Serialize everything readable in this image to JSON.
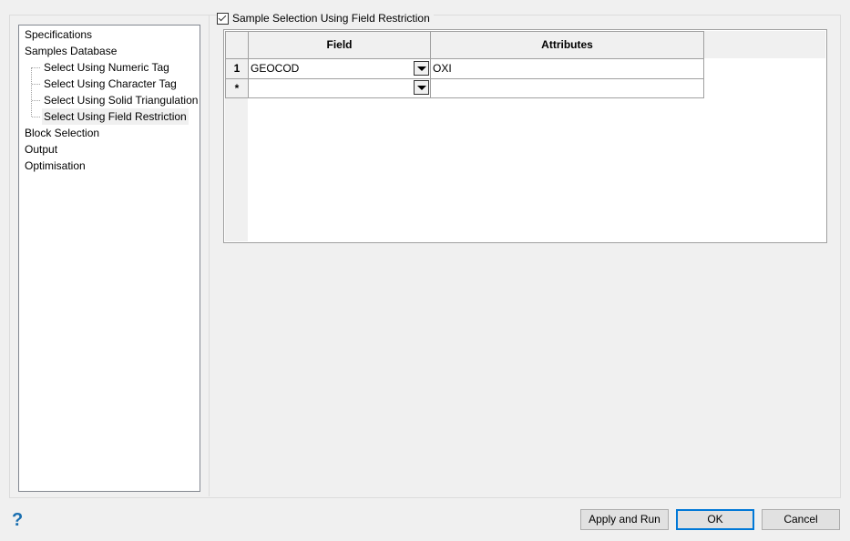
{
  "tree": {
    "items": [
      {
        "label": "Specifications",
        "child": false,
        "selected": false
      },
      {
        "label": "Samples Database",
        "child": false,
        "selected": false
      },
      {
        "label": "Select Using Numeric Tag",
        "child": true,
        "selected": false
      },
      {
        "label": "Select Using Character Tag",
        "child": true,
        "selected": false
      },
      {
        "label": "Select Using Solid Triangulation",
        "child": true,
        "selected": false
      },
      {
        "label": "Select Using Field Restriction",
        "child": true,
        "selected": true
      },
      {
        "label": "Block Selection",
        "child": false,
        "selected": false
      },
      {
        "label": "Output",
        "child": false,
        "selected": false
      },
      {
        "label": "Optimisation",
        "child": false,
        "selected": false
      }
    ]
  },
  "section": {
    "checkbox_label": "Sample Selection Using Field Restriction",
    "checked": true
  },
  "grid": {
    "headers": [
      "Field",
      "Attributes"
    ],
    "rows": [
      {
        "num": "1",
        "field": "GEOCOD",
        "attributes": "OXI"
      },
      {
        "num": "*",
        "field": "",
        "attributes": ""
      }
    ]
  },
  "footer": {
    "help": "?",
    "apply_run": "Apply and Run",
    "ok": "OK",
    "cancel": "Cancel"
  }
}
